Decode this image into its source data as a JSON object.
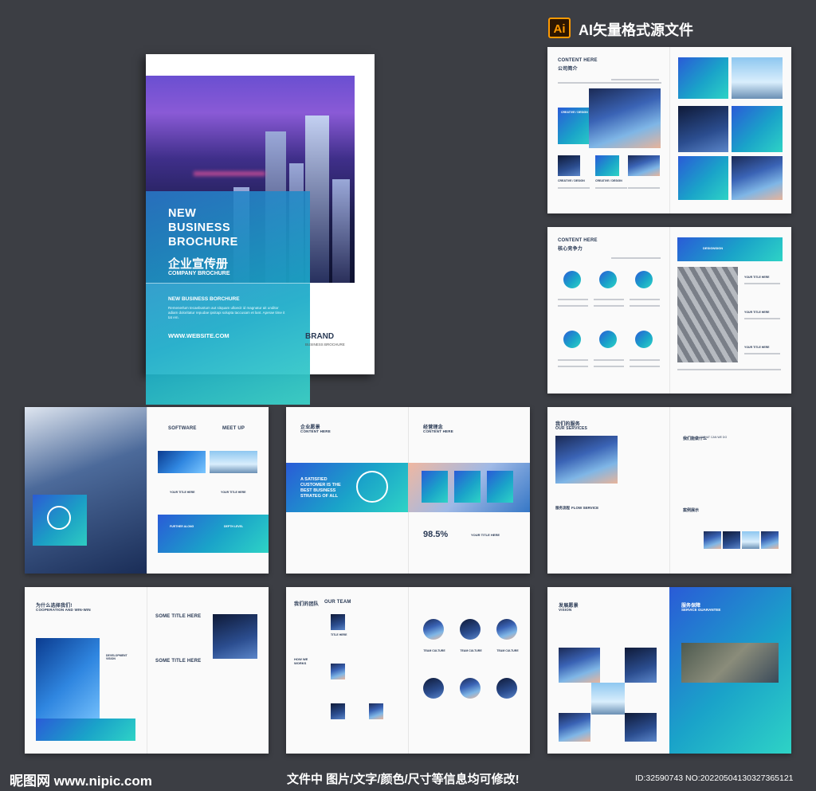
{
  "header": {
    "ai_badge": "Ai",
    "title": "AI矢量格式源文件"
  },
  "cover": {
    "line1": "NEW",
    "line2": "BUSINESS",
    "line3": "BROCHURE",
    "cn_title": "企业宣传册",
    "subtitle": "COMPANY BROCHURE",
    "tagline": "NEW BUSINESS BORCHURE",
    "body": "Remenerlum tecaebustum aut sitquam ulloecit id magnatur ait unditor adiam doloritatur repudae ipsitapi solupta taccusam et lant. Aperae time it tat em.",
    "website": "WWW.WEBSITE.COM",
    "brand": "BRAND",
    "brand_sub": "BUSINESS BROCHURE"
  },
  "spreads": {
    "s1": {
      "heading": "CONTENT HERE",
      "cn": "公司简介",
      "label1": "CREATIVE / DESIGN",
      "label2": "CREATIVE / DESIGN",
      "label3": "CREATIVE / DESIGN"
    },
    "s2": {
      "heading": "CONTENT HERE",
      "cn": "核心竞争力",
      "right_label": "DESIGNSIGN",
      "item": "YOUR TITLE HERE"
    },
    "s3": {
      "software": "SOFTWARE",
      "meetup": "MEET UP",
      "your_title": "YOUR TITLE HERE",
      "further": "FURTHER ALONG",
      "depth": "DEPTH LEVEL"
    },
    "s4": {
      "cn1": "企业愿景",
      "content1": "CONTENT HERE",
      "cn2": "经营理念",
      "content2": "CONTENT HERE",
      "quote": "A SATISFIED CUSTOMER IS THE BEST BUSINESS STRATEG OF ALL",
      "percent": "98.5%",
      "your_title": "YOUR TITLE HERE"
    },
    "s5": {
      "cn1": "我们的服务",
      "en1": "OUR SERVICES",
      "cn2": "我们能做什么",
      "en2": "WHAT CAN WE DO",
      "flow_cn": "服务流程",
      "flow_en": "FLOW SERVICE",
      "case_cn": "案例展示"
    },
    "s6": {
      "cn": "为什么选择我们!",
      "en": "COOPERATION AND WIN-WIN",
      "some1": "SOME TITLE HERE",
      "some2": "SOME TITLE HERE",
      "dev": "DEVELOPMENT VISION"
    },
    "s7": {
      "cn": "我们的团队",
      "en": "OUR TEAM",
      "how": "HOW WE WORKS",
      "title_here": "TITLE HERE",
      "team": "TEAM CULTURE"
    },
    "s8": {
      "cn1": "发展愿景",
      "en1": "VISION",
      "cn2": "服务保障",
      "en2": "SERVICE GUARANTEE"
    }
  },
  "footer": {
    "logo": "昵图网 www.nipic.com",
    "notice": "文件中 图片/文字/颜色/尺寸等信息均可修改!",
    "id": "ID:32590743 NO:20220504130327365121"
  }
}
